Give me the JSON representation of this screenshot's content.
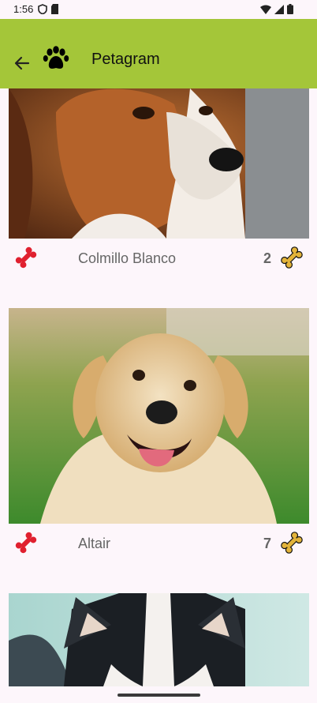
{
  "status_bar": {
    "time": "1:56",
    "icons": [
      "shield-icon",
      "sd-card-icon",
      "wifi-icon",
      "signal-icon",
      "battery-icon"
    ]
  },
  "app_bar": {
    "title": "Petagram",
    "background": "#a4c639",
    "icons": [
      "back-arrow-icon",
      "paw-icon"
    ]
  },
  "pets": [
    {
      "name": "Colmillo Blanco",
      "likes": "2",
      "photo": "dog-photo-collie-brown-white"
    },
    {
      "name": "Altair",
      "likes": "7",
      "photo": "dog-photo-golden-retriever"
    },
    {
      "name": "",
      "likes": "",
      "photo": "dog-photo-husky"
    }
  ],
  "icons": {
    "like": "red-bone-icon",
    "rating": "yellow-bone-icon"
  },
  "colors": {
    "like_bone": "#e0202f",
    "rating_bone": "#e3b43a",
    "text_secondary": "#666666"
  }
}
